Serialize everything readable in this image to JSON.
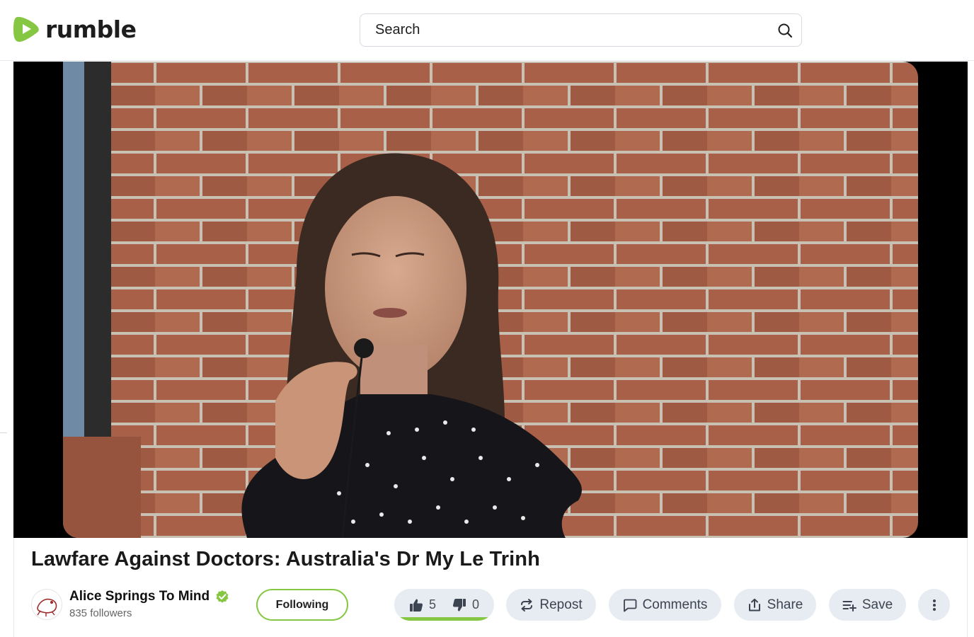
{
  "header": {
    "logo_text": "rumble",
    "search_placeholder": "Search"
  },
  "colors": {
    "brand_green": "#85c742",
    "pill_background": "#e6ecf2",
    "verified_green": "#85c742"
  },
  "video": {
    "title": "Lawfare Against Doctors: Australia's Dr My Le Trinh"
  },
  "channel": {
    "name": "Alice Springs To Mind",
    "followers": "835 followers",
    "verified": true,
    "follow_label": "Following"
  },
  "actions": {
    "likes": "5",
    "dislikes": "0",
    "like_ratio": 1.0,
    "repost_label": "Repost",
    "comments_label": "Comments",
    "share_label": "Share",
    "save_label": "Save"
  },
  "icons": {
    "search": "search-icon",
    "like": "thumbs-up-icon",
    "dislike": "thumbs-down-icon",
    "repost": "repost-icon",
    "comments": "comment-icon",
    "share": "share-icon",
    "save": "playlist-add-icon",
    "more": "more-vertical-icon",
    "verified": "verified-check-icon"
  }
}
